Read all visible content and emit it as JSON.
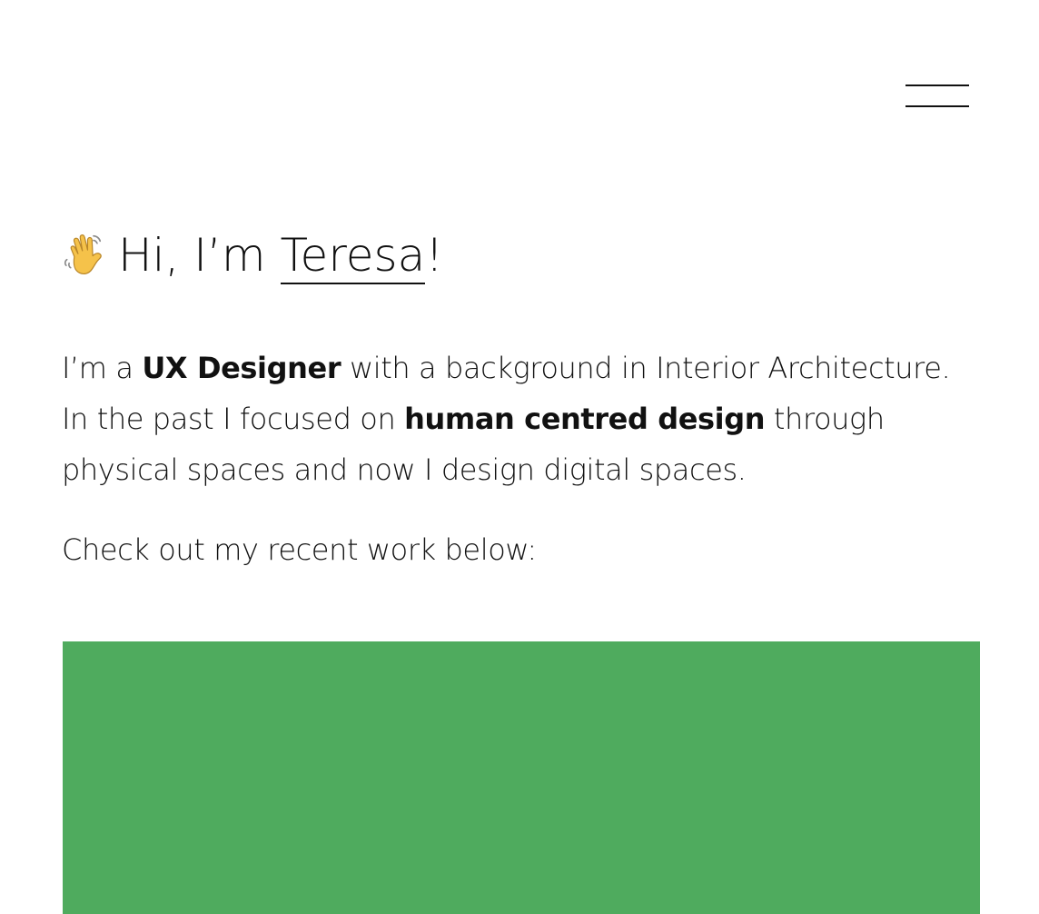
{
  "header": {
    "menu_icon": "hamburger-menu-icon"
  },
  "hero": {
    "wave_icon": "waving-hand-icon",
    "greeting_prefix": "Hi, I’m ",
    "name": "Teresa",
    "greeting_suffix": "!"
  },
  "intro": {
    "part1": "I’m a ",
    "role": "UX Designer",
    "part2": " with a background in Interior Architecture. In the past I focused on ",
    "focus": "human centred design",
    "part3": " through physical spaces and now I design digital spaces."
  },
  "cta": {
    "text": "Check out my recent work below:"
  },
  "colors": {
    "project_card": "#4fab5e",
    "text": "#111111",
    "background": "#ffffff"
  }
}
